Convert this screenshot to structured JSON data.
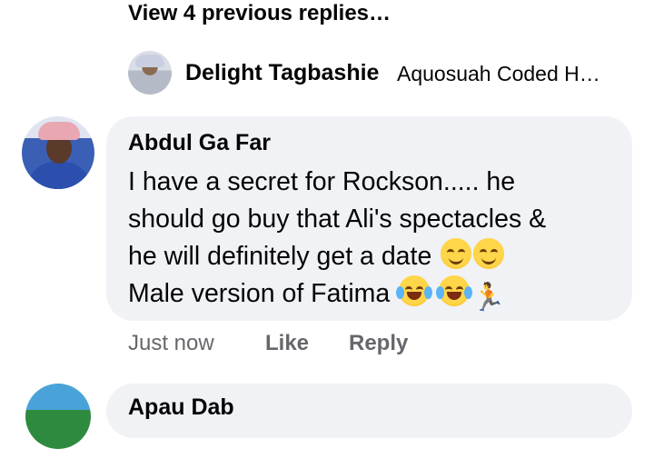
{
  "thread": {
    "view_previous": "View 4 previous replies…"
  },
  "reply_preview": {
    "author": "Delight Tagbashie",
    "text": "Aquosuah Coded H…"
  },
  "comment": {
    "author": "Abdul Ga Far",
    "lines": [
      "I have a secret for Rockson.....   he",
      "should go buy that Ali's spectacles &",
      "he will definitely get a date",
      "Male version of Fatima"
    ],
    "emojis_line3": [
      "smiling-face-emoji",
      "smiling-face-emoji"
    ],
    "emojis_line4": [
      "tears-of-joy-emoji",
      "tears-of-joy-emoji",
      "person-running-emoji"
    ]
  },
  "actions": {
    "time": "Just now",
    "like": "Like",
    "reply": "Reply"
  },
  "next_comment": {
    "author_partial": "Apau Dab"
  }
}
